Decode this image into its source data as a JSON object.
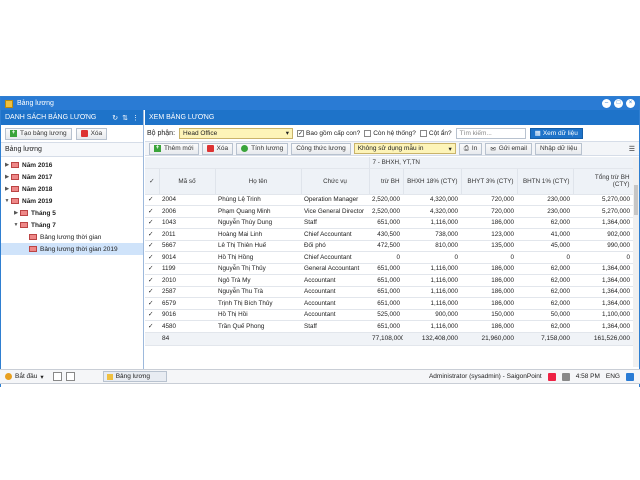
{
  "window": {
    "title": "Bảng lương"
  },
  "left": {
    "header": "DANH SÁCH BẢNG LƯƠNG",
    "add_label": "Tạo bảng lương",
    "delete_label": "Xóa",
    "section_label": "Bảng lương",
    "tree": [
      {
        "label": "Năm 2016",
        "level": 0,
        "expanded": false,
        "bold": true
      },
      {
        "label": "Năm 2017",
        "level": 0,
        "expanded": false,
        "bold": true
      },
      {
        "label": "Năm 2018",
        "level": 0,
        "expanded": false,
        "bold": true
      },
      {
        "label": "Năm 2019",
        "level": 0,
        "expanded": true,
        "bold": true
      },
      {
        "label": "Tháng 5",
        "level": 1,
        "expanded": false,
        "bold": true
      },
      {
        "label": "Tháng 7",
        "level": 1,
        "expanded": true,
        "bold": true
      },
      {
        "label": "Bảng lương thời gian",
        "level": 2,
        "bold": false
      },
      {
        "label": "Bảng lương thời gian 2019",
        "level": 2,
        "bold": false,
        "selected": true
      }
    ]
  },
  "right": {
    "header": "XEM BẢNG LƯƠNG",
    "filter": {
      "dept_label": "Bộ phận:",
      "dept_value": "Head Office",
      "include_sub_label": "Bao gồm cấp con?",
      "active_label": "Còn hệ thống?",
      "hidden_label": "Cột ẩn?",
      "search_placeholder": "Tìm kiếm...",
      "view_button": "Xem dữ liệu"
    },
    "toolbar": {
      "add": "Thêm mới",
      "delete": "Xóa",
      "calc": "Tính lương",
      "formula": "Công thức lương",
      "template_select": "Không sử dụng mẫu in",
      "print": "In",
      "email": "Gửi email",
      "import": "Nhập dữ liệu"
    },
    "table": {
      "group_header": "7 - BHXH, YT,TN",
      "columns": [
        "Mã số",
        "Họ tên",
        "Chức vụ",
        "trừ BH",
        "BHXH 18% (CTY)",
        "BHYT 3% (CTY)",
        "BHTN 1% (CTY)",
        "Tổng trừ BH (CTY)"
      ],
      "rows": [
        {
          "code": "2004",
          "name": "Phùng Lệ Trinh",
          "position": "Operation Manager",
          "bh": "2,520,000",
          "bhxh": "4,320,000",
          "bhyt": "720,000",
          "bhtn": "230,000",
          "total": "5,270,000"
        },
        {
          "code": "2006",
          "name": "Phạm Quang Minh",
          "position": "Vice General Director",
          "bh": "2,520,000",
          "bhxh": "4,320,000",
          "bhyt": "720,000",
          "bhtn": "230,000",
          "total": "5,270,000"
        },
        {
          "code": "1043",
          "name": "Nguyễn Thùy Dung",
          "position": "Staff",
          "bh": "651,000",
          "bhxh": "1,116,000",
          "bhyt": "186,000",
          "bhtn": "62,000",
          "total": "1,364,000"
        },
        {
          "code": "2011",
          "name": "Hoàng Mai Linh",
          "position": "Chief Accountant",
          "bh": "430,500",
          "bhxh": "738,000",
          "bhyt": "123,000",
          "bhtn": "41,000",
          "total": "902,000"
        },
        {
          "code": "5667",
          "name": "Lê Thị Thiên Huế",
          "position": "Đối phó",
          "bh": "472,500",
          "bhxh": "810,000",
          "bhyt": "135,000",
          "bhtn": "45,000",
          "total": "990,000"
        },
        {
          "code": "9014",
          "name": "Hồ Thị Hồng",
          "position": "Chief Accountant",
          "bh": "0",
          "bhxh": "0",
          "bhyt": "0",
          "bhtn": "0",
          "total": "0"
        },
        {
          "code": "1199",
          "name": "Nguyễn Thị Thủy",
          "position": "General Accountant",
          "bh": "651,000",
          "bhxh": "1,116,000",
          "bhyt": "186,000",
          "bhtn": "62,000",
          "total": "1,364,000"
        },
        {
          "code": "2010",
          "name": "Ngô Trà My",
          "position": "Accountant",
          "bh": "651,000",
          "bhxh": "1,116,000",
          "bhyt": "186,000",
          "bhtn": "62,000",
          "total": "1,364,000"
        },
        {
          "code": "2587",
          "name": "Nguyễn Thu Trà",
          "position": "Accountant",
          "bh": "651,000",
          "bhxh": "1,116,000",
          "bhyt": "186,000",
          "bhtn": "62,000",
          "total": "1,364,000"
        },
        {
          "code": "6579",
          "name": "Trịnh Thị Bích Thủy",
          "position": "Accountant",
          "bh": "651,000",
          "bhxh": "1,116,000",
          "bhyt": "186,000",
          "bhtn": "62,000",
          "total": "1,364,000"
        },
        {
          "code": "9016",
          "name": "Hồ Thị Hồi",
          "position": "Accountant",
          "bh": "525,000",
          "bhxh": "900,000",
          "bhyt": "150,000",
          "bhtn": "50,000",
          "total": "1,100,000"
        },
        {
          "code": "4580",
          "name": "Trần Quế Phong",
          "position": "Staff",
          "bh": "651,000",
          "bhxh": "1,116,000",
          "bhyt": "186,000",
          "bhtn": "62,000",
          "total": "1,364,000"
        }
      ],
      "summary": {
        "count": "84",
        "bh": "77,108,000",
        "bhxh": "132,408,000",
        "bhyt": "21,960,000",
        "bhtn": "7,158,000",
        "total": "161,526,000"
      }
    }
  },
  "taskbar": {
    "start": "Bắt đầu",
    "task": "Bảng lương",
    "user": "Administrator (sysadmin) - SaigonPoint",
    "time": "4:58 PM",
    "lang": "ENG"
  }
}
